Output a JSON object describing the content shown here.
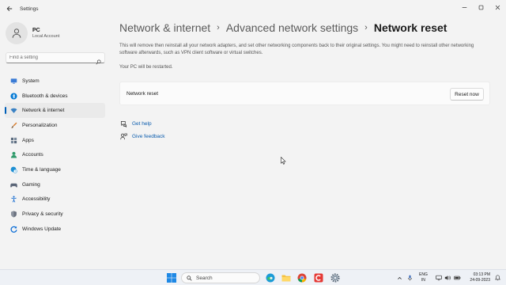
{
  "window": {
    "title": "Settings"
  },
  "profile": {
    "name": "PC",
    "account_type": "Local Account"
  },
  "search": {
    "placeholder": "Find a setting"
  },
  "nav": {
    "items": [
      {
        "label": "System",
        "icon": "monitor-icon",
        "color": "#3a7bd5"
      },
      {
        "label": "Bluetooth & devices",
        "icon": "bluetooth-icon",
        "color": "#0078d4"
      },
      {
        "label": "Network & internet",
        "icon": "wifi-icon",
        "color": "#3b82c4"
      },
      {
        "label": "Personalization",
        "icon": "brush-icon",
        "color": "#d97c2b"
      },
      {
        "label": "Apps",
        "icon": "apps-icon",
        "color": "#5b6b7e"
      },
      {
        "label": "Accounts",
        "icon": "person-icon",
        "color": "#2e9a6a"
      },
      {
        "label": "Time & language",
        "icon": "globe-clock-icon",
        "color": "#1d8fd3"
      },
      {
        "label": "Gaming",
        "icon": "gamepad-icon",
        "color": "#5a6577"
      },
      {
        "label": "Accessibility",
        "icon": "accessibility-icon",
        "color": "#1b6fd1"
      },
      {
        "label": "Privacy & security",
        "icon": "shield-icon",
        "color": "#6b7280"
      },
      {
        "label": "Windows Update",
        "icon": "update-icon",
        "color": "#0a6cd6"
      }
    ],
    "active_index": 2
  },
  "breadcrumb": {
    "level1": "Network & internet",
    "level2": "Advanced network settings",
    "current": "Network reset",
    "separator": "›"
  },
  "main": {
    "description": "This will remove then reinstall all your network adapters, and set other networking components back to their original settings. You might need to reinstall other networking software afterwards, such as VPN client software or virtual switches.",
    "restart_note": "Your PC will be restarted.",
    "card_label": "Network reset",
    "reset_button": "Reset now",
    "links": [
      {
        "label": "Get help",
        "icon": "help-icon"
      },
      {
        "label": "Give feedback",
        "icon": "feedback-icon"
      }
    ]
  },
  "taskbar": {
    "search_label": "Search",
    "tray": {
      "lang_line1": "ENG",
      "lang_line2": "IN",
      "time": "03:13 PM",
      "date": "24-09-2023"
    }
  },
  "colors": {
    "accent": "#005fb8",
    "link": "#0b5cad",
    "background": "#f3f3f3"
  }
}
